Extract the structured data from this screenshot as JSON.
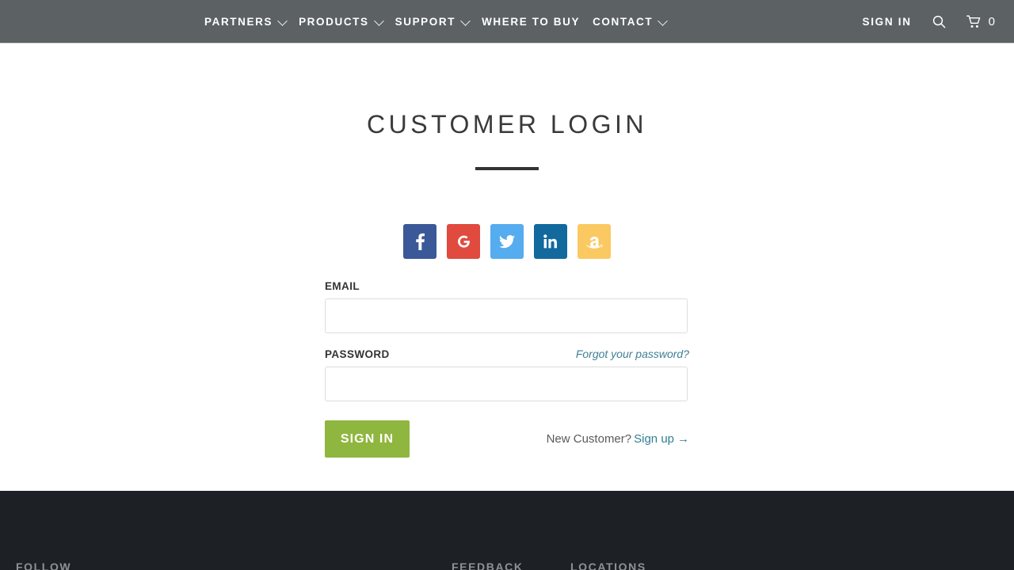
{
  "nav": {
    "items": [
      {
        "label": "PARTNERS",
        "has_caret": true,
        "icon": "chevron-down-icon"
      },
      {
        "label": "PRODUCTS",
        "has_caret": true,
        "icon": "chevron-down-icon"
      },
      {
        "label": "SUPPORT",
        "has_caret": true,
        "icon": "chevron-down-icon"
      },
      {
        "label": "WHERE TO BUY",
        "has_caret": false,
        "icon": ""
      },
      {
        "label": "CONTACT",
        "has_caret": true,
        "icon": "chevron-down-icon"
      }
    ],
    "sign_in_label": "SIGN IN",
    "search_icon": "search-icon",
    "cart_icon": "shopping-cart-icon",
    "cart_count": "0",
    "background_color": "#5c6164",
    "text_color": "#ffffff"
  },
  "page": {
    "title": "CUSTOMER LOGIN"
  },
  "social": {
    "buttons": [
      {
        "name": "facebook",
        "icon": "facebook-icon",
        "glyph": "f",
        "color": "#3b5998"
      },
      {
        "name": "google",
        "icon": "google-icon",
        "glyph": "G",
        "color": "#e04a3f"
      },
      {
        "name": "twitter",
        "icon": "twitter-icon",
        "glyph": "t",
        "color": "#55acee"
      },
      {
        "name": "linkedin",
        "icon": "linkedin-icon",
        "glyph": "in",
        "color": "#11699e"
      },
      {
        "name": "amazon",
        "icon": "amazon-icon",
        "glyph": "a",
        "color": "#fbc962"
      }
    ]
  },
  "form": {
    "email_label": "EMAIL",
    "email_value": "",
    "email_placeholder": "",
    "password_label": "PASSWORD",
    "password_value": "",
    "password_placeholder": "",
    "forgot_label": "Forgot your password?",
    "submit_label": "SIGN IN",
    "submit_color": "#8fb63e",
    "new_customer_text": "New Customer?",
    "signup_label": "Sign up",
    "signup_arrow": "→",
    "link_color": "#2f7e92"
  },
  "footer": {
    "background_color": "#1d2125",
    "columns": [
      {
        "heading": "FOLLOW"
      },
      {
        "heading": "FEEDBACK"
      },
      {
        "heading": "LOCATIONS"
      }
    ]
  }
}
